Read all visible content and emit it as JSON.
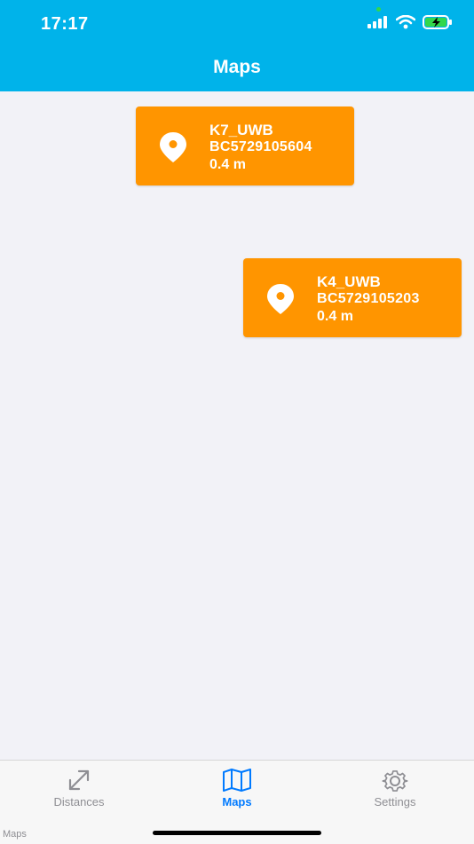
{
  "status_bar": {
    "time": "17:17"
  },
  "header": {
    "title": "Maps"
  },
  "devices": [
    {
      "name": "K7_UWB",
      "serial": "BC5729105604",
      "distance": "0.4 m",
      "icon": "location-pin-icon"
    },
    {
      "name": "K4_UWB",
      "serial": "BC5729105203",
      "distance": "0.4 m",
      "icon": "location-pin-icon"
    }
  ],
  "tabs": [
    {
      "label": "Distances",
      "icon": "distance-arrows-icon",
      "active": false
    },
    {
      "label": "Maps",
      "icon": "map-icon",
      "active": true
    },
    {
      "label": "Settings",
      "icon": "gear-icon",
      "active": false
    }
  ],
  "footer": {
    "label": "Maps"
  },
  "colors": {
    "header": "#00b3ea",
    "card": "#ff9500",
    "active_tab": "#007aff",
    "inactive_tab": "#8e8e93"
  }
}
